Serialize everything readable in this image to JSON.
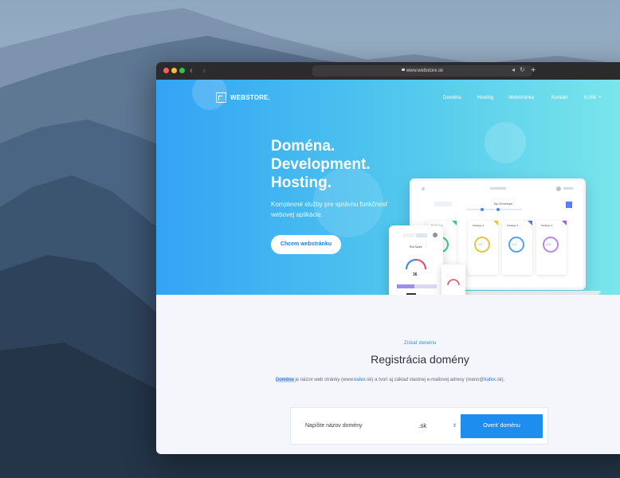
{
  "browser": {
    "url": "www.webstore.sk",
    "nav_back": "‹",
    "nav_forward": "›",
    "new_tab": "+"
  },
  "site": {
    "logo": "WEBSTORE.",
    "nav": [
      "Doména",
      "Hosting",
      "Webstránka",
      "Kontakt",
      "Košík"
    ],
    "cart_chevron": "˅"
  },
  "hero": {
    "headline": [
      "Doména.",
      "Development.",
      "Hosting."
    ],
    "subtitle": "Komplexné služby pre správnu funkčnosť webovej aplikácie.",
    "cta": "Chcem webstránku"
  },
  "mockup": {
    "panel_titles": [
      "Package 1",
      "Package 2",
      "Package 3",
      "Package 4"
    ],
    "panel_values": [
      "2\"",
      "13\"",
      "1.2\"",
      "1.5\""
    ],
    "score_label": "Rot Score",
    "score_value": "36",
    "top_label": "Top Envelope"
  },
  "domain_section": {
    "kicker": "Získať doménu",
    "title": "Registrácia domény",
    "desc_highlight": "Doména",
    "desc_part1": " je názov web stránky (www.",
    "desc_link1": "kafex",
    "desc_part2": ".sk) a tvorí aj základ vlastnej e-mailovej adresy (meno@",
    "desc_link2": "kafex",
    "desc_part3": ".sk).",
    "input_placeholder": "Napíšte názov domény",
    "tld": ".sk",
    "verify_button": "Overiť doménu"
  },
  "colors": {
    "hero_start": "#33a3f4",
    "hero_end": "#7be8ea",
    "accent": "#1d8df0"
  }
}
